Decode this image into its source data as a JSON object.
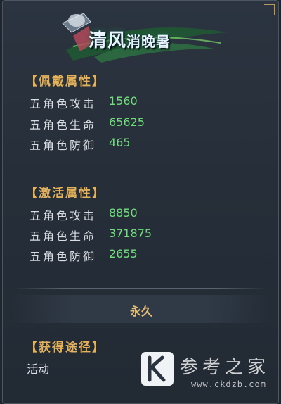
{
  "title_main": "清风",
  "title_small": "消晚暑",
  "wear": {
    "heading": "【佩戴属性】",
    "rows": [
      {
        "label": "五角色攻击",
        "value": "1560"
      },
      {
        "label": "五角色生命",
        "value": "65625"
      },
      {
        "label": "五角色防御",
        "value": "465"
      }
    ]
  },
  "activate": {
    "heading": "【激活属性】",
    "rows": [
      {
        "label": "五角色攻击",
        "value": "8850"
      },
      {
        "label": "五角色生命",
        "value": "371875"
      },
      {
        "label": "五角色防御",
        "value": "2655"
      }
    ]
  },
  "duration": "永久",
  "source": {
    "heading": "【获得途径】",
    "value": "活动"
  },
  "watermark": {
    "text": "参考之家",
    "url": "www.ckdzb.com",
    "logo": "K"
  },
  "colors": {
    "heading": "#e3b25c",
    "value": "#6fe07a",
    "label": "#d9dde2"
  }
}
